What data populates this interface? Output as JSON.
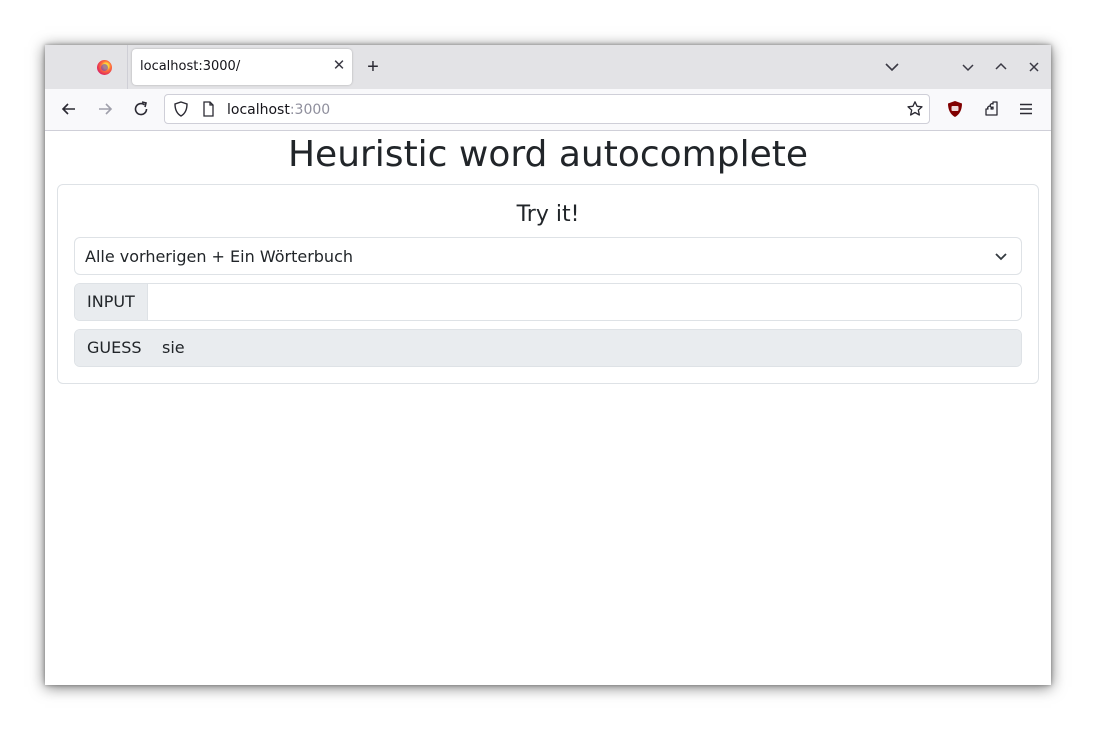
{
  "browser": {
    "tab": {
      "title": "localhost:3000/",
      "close_glyph": "✕"
    },
    "new_tab_glyph": "+",
    "url": {
      "host": "localhost",
      "port": ":3000"
    }
  },
  "page": {
    "title": "Heuristic word autocomplete",
    "card": {
      "title": "Try it!",
      "select": {
        "value": "Alle vorherigen + Ein Wörterbuch"
      },
      "input": {
        "label": "INPUT",
        "value": "",
        "placeholder": ""
      },
      "guess": {
        "label": "GUESS",
        "value": "sie"
      }
    }
  },
  "icons": [
    "firefox-icon",
    "back-icon",
    "forward-icon",
    "reload-icon",
    "shield-icon",
    "page-icon",
    "star-icon",
    "ublock-icon",
    "extensions-icon",
    "menu-icon",
    "list-tabs-icon",
    "minimize-icon",
    "maximize-icon",
    "close-icon",
    "chevron-down-icon"
  ]
}
